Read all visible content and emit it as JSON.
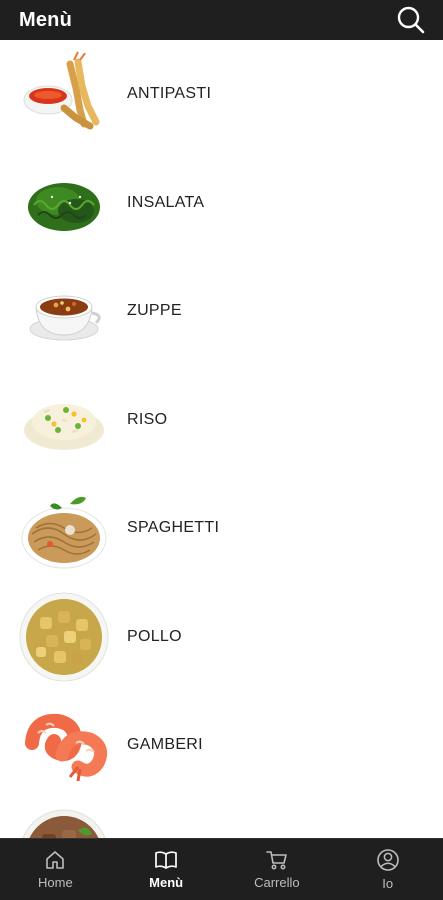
{
  "header": {
    "title": "Menù",
    "search_icon": "search-icon"
  },
  "categories": [
    {
      "label": "ANTIPASTI",
      "icon": "appetizer-plate"
    },
    {
      "label": "INSALATA",
      "icon": "seaweed-salad"
    },
    {
      "label": "ZUPPE",
      "icon": "soup-bowl"
    },
    {
      "label": "RISO",
      "icon": "fried-rice"
    },
    {
      "label": "SPAGHETTI",
      "icon": "noodles"
    },
    {
      "label": "POLLO",
      "icon": "chicken-dish"
    },
    {
      "label": "GAMBERI",
      "icon": "shrimp"
    },
    {
      "label": "",
      "icon": "beef-dish"
    }
  ],
  "tabs": [
    {
      "label": "Home",
      "icon": "home-icon",
      "active": false
    },
    {
      "label": "Menù",
      "icon": "book-icon",
      "active": true
    },
    {
      "label": "Carrello",
      "icon": "cart-icon",
      "active": false
    },
    {
      "label": "Io",
      "icon": "user-icon",
      "active": false
    }
  ],
  "colors": {
    "bar_background": "#1f1f1f",
    "active_tab": "#ffffff",
    "inactive_tab": "#bdbdbd"
  }
}
